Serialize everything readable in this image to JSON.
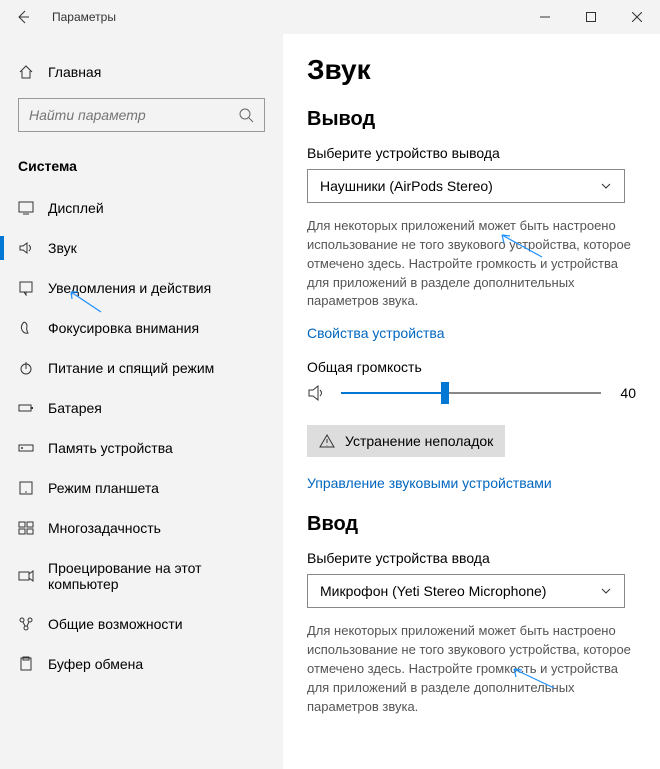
{
  "titlebar": {
    "title": "Параметры"
  },
  "sidebar": {
    "home": "Главная",
    "search_placeholder": "Найти параметр",
    "section": "Система",
    "items": [
      {
        "label": "Дисплей"
      },
      {
        "label": "Звук"
      },
      {
        "label": "Уведомления и действия"
      },
      {
        "label": "Фокусировка внимания"
      },
      {
        "label": "Питание и спящий режим"
      },
      {
        "label": "Батарея"
      },
      {
        "label": "Память устройства"
      },
      {
        "label": "Режим планшета"
      },
      {
        "label": "Многозадачность"
      },
      {
        "label": "Проецирование на этот компьютер"
      },
      {
        "label": "Общие возможности"
      },
      {
        "label": "Буфер обмена"
      }
    ]
  },
  "main": {
    "page_title": "Звук",
    "output": {
      "title": "Вывод",
      "label": "Выберите устройство вывода",
      "selected": "Наушники (AirPods Stereo)",
      "desc": "Для некоторых приложений может быть настроено использование не того звукового устройства, которое отмечено здесь. Настройте громкость и устройства для приложений в разделе дополнительных параметров звука.",
      "props_link": "Свойства устройства",
      "volume_label": "Общая громкость",
      "volume_value": 40,
      "troubleshoot": "Устранение неполадок",
      "manage_link": "Управление звуковыми устройствами"
    },
    "input": {
      "title": "Ввод",
      "label": "Выберите устройства ввода",
      "selected": "Микрофон (Yeti Stereo Microphone)",
      "desc": "Для некоторых приложений может быть настроено использование не того звукового устройства, которое отмечено здесь. Настройте громкость и устройства для приложений в разделе дополнительных параметров звука."
    }
  }
}
